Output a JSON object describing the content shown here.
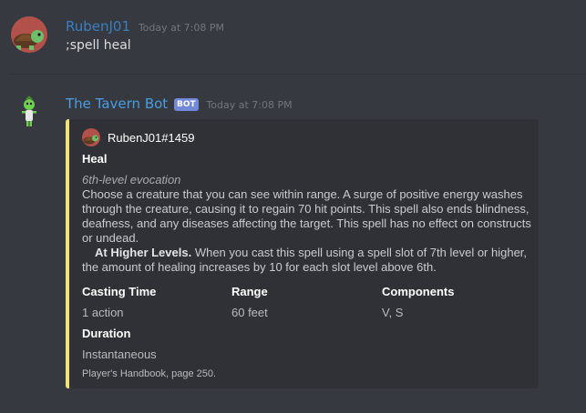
{
  "messages": [
    {
      "author": "RubenJ01",
      "author_color": "#3c7fbf",
      "timestamp": "Today at 7:08 PM",
      "text": ";spell heal",
      "avatar_icon": "turtle-icon"
    },
    {
      "author": "The Tavern Bot",
      "author_color": "#4a9de0",
      "bot_tag": "BOT",
      "timestamp": "Today at 7:08 PM",
      "avatar_icon": "goblin-icon"
    }
  ],
  "embed": {
    "accent_color": "#f0e27c",
    "author": "RubenJ01#1459",
    "title": "Heal",
    "subtitle": "6th-level evocation",
    "description": "Choose a creature that you can see within range. A surge of positive energy washes through the creature, causing it to regain 70 hit points. This spell also ends blindness, deafness, and any diseases affecting the target. This spell has no effect on constructs or undead.",
    "higher_levels_label": "At Higher Levels.",
    "higher_levels_text": "When you cast this spell using a spell slot of 7th level or higher, the amount of healing increases by 10 for each slot level above 6th.",
    "fields": [
      {
        "name": "Casting Time",
        "value": "1 action"
      },
      {
        "name": "Range",
        "value": "60 feet"
      },
      {
        "name": "Components",
        "value": "V, S"
      },
      {
        "name": "Duration",
        "value": "Instantaneous"
      }
    ],
    "footer": "Player's Handbook, page 250."
  }
}
